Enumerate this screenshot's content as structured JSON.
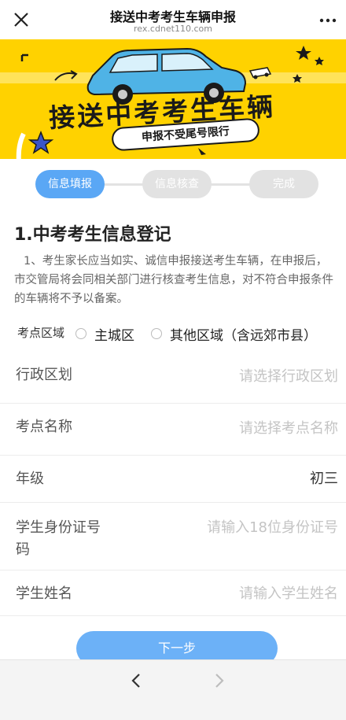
{
  "header": {
    "title": "接送中考考生车辆申报",
    "url": "rex.cdnet110.com",
    "close_icon": "close-icon",
    "more_icon": "more-icon"
  },
  "banner": {
    "headline": "接送中考考生车辆",
    "pill_text": "申报不受尾号限行",
    "background_color": "#ffd200",
    "car_color": "#4fb3e6"
  },
  "steps": [
    {
      "label": "信息填报",
      "state": "active"
    },
    {
      "label": "信息核查",
      "state": "inactive"
    },
    {
      "label": "完成",
      "state": "inactive"
    }
  ],
  "form": {
    "section_title": "1.中考考生信息登记",
    "notice": "1、考生家长应当如实、诚信申报接送考生车辆，在申报后，市交管局将会同相关部门进行核查考生信息，对不符合申报条件的车辆将不予以备案。",
    "region": {
      "label": "考点区域",
      "options": [
        "主城区",
        "其他区域（含远郊市县）"
      ]
    },
    "fields": {
      "district": {
        "label": "行政区划",
        "placeholder": "请选择行政区划"
      },
      "exam_site": {
        "label": "考点名称",
        "placeholder": "请选择考点名称"
      },
      "grade": {
        "label": "年级",
        "value": "初三"
      },
      "id_number": {
        "label_line1": "学生身份证号",
        "label_line2": "码",
        "placeholder": "请输入18位身份证号"
      },
      "student_name": {
        "label": "学生姓名",
        "placeholder": "请输入学生姓名"
      }
    },
    "next_button": "下一步"
  },
  "bottom_nav": {
    "back_icon": "chevron-left-icon",
    "forward_icon": "chevron-right-icon"
  },
  "colors": {
    "accent": "#5aa7f5",
    "button": "#6cb1f7",
    "inactive_step": "#e2e2e2"
  }
}
